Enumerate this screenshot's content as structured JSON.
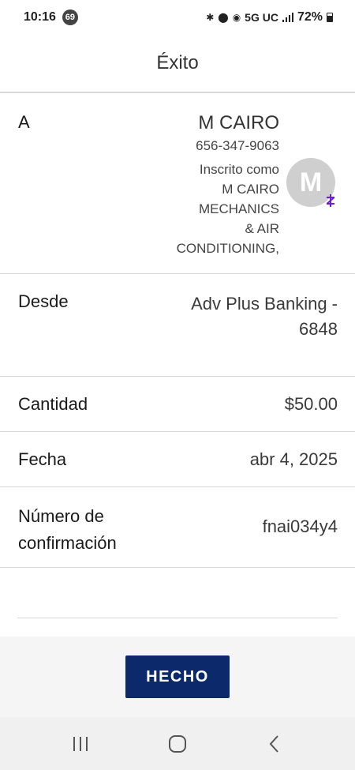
{
  "status_bar": {
    "time": "10:16",
    "notification_count": "69",
    "network": "5G UC",
    "battery": "72%"
  },
  "header": {
    "title": "Éxito"
  },
  "recipient": {
    "label": "A",
    "name": "M CAIRO",
    "phone": "656-347-9063",
    "enrolled_line1": "Inscrito como",
    "enrolled_line2": "M CAIRO",
    "enrolled_line3": "MECHANICS",
    "enrolled_line4": "& AIR",
    "enrolled_line5": "CONDITIONING,",
    "avatar_initial": "M"
  },
  "from": {
    "label": "Desde",
    "value_line1": "Adv Plus Banking -",
    "value_line2": "6848"
  },
  "amount": {
    "label": "Cantidad",
    "value": "$50.00"
  },
  "date": {
    "label": "Fecha",
    "value": "abr 4, 2025"
  },
  "confirmation": {
    "label_line1": "Número de",
    "label_line2": "confirmación",
    "value": "fnai034y4"
  },
  "actions": {
    "done_label": "HECHO"
  },
  "colors": {
    "primary_button": "#0c2a6b",
    "zelle_accent": "#6d1ed4"
  }
}
